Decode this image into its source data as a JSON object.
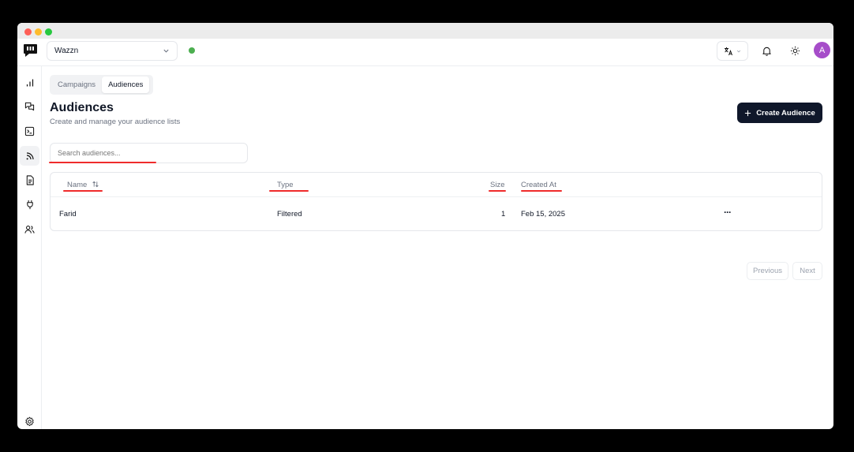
{
  "workspace": {
    "name": "Wazzn"
  },
  "header": {
    "avatar_initial": "A"
  },
  "tabs": [
    {
      "label": "Campaigns"
    },
    {
      "label": "Audiences"
    }
  ],
  "page": {
    "title": "Audiences",
    "subtitle": "Create and manage your audience lists",
    "create_label": "Create Audience"
  },
  "search": {
    "placeholder": "Search audiences..."
  },
  "table": {
    "columns": [
      "Name",
      "Type",
      "Size",
      "Created At"
    ],
    "rows": [
      {
        "name": "Farid",
        "type": "Filtered",
        "size": "1",
        "created_at": "Feb 15, 2025",
        "actions": "···"
      }
    ]
  },
  "pagination": {
    "previous": "Previous",
    "next": "Next"
  },
  "colors": {
    "accent": "#0f172a",
    "avatar": "#a64dc9",
    "status": "#4caf50",
    "annotation": "#ef2b2b"
  }
}
